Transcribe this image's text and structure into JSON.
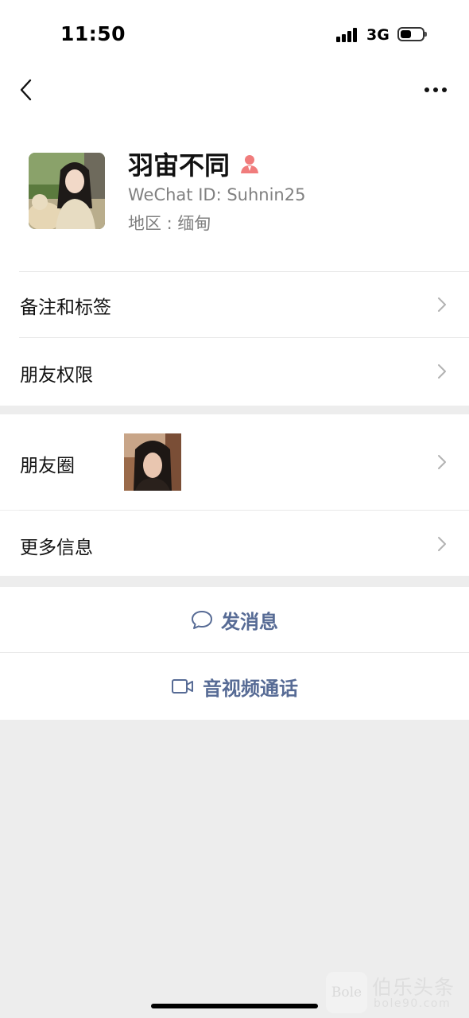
{
  "status_bar": {
    "time": "11:50",
    "network": "3G",
    "signal_icon": "signal-bars-icon",
    "battery_icon": "battery-icon"
  },
  "nav": {
    "back_icon": "chevron-left-icon",
    "more_icon": "more-dots-icon"
  },
  "profile": {
    "name": "羽宙不同",
    "gender_icon": "female-person-icon",
    "wechat_id": "WeChat ID: Suhnin25",
    "region": "地区 : 缅甸"
  },
  "menu": {
    "remarks_tags": "备注和标签",
    "friend_permissions": "朋友权限",
    "moments": "朋友圈",
    "more_info": "更多信息"
  },
  "actions": {
    "send_message": "发消息",
    "video_call": "音视频通话"
  },
  "watermark": {
    "logo_text": "Bole",
    "title": "伯乐头条",
    "url": "bole90.com"
  },
  "colors": {
    "link": "#576b95",
    "background": "#ededed",
    "gender_icon": "#f07c7c",
    "chevron": "#b2b2b2"
  }
}
